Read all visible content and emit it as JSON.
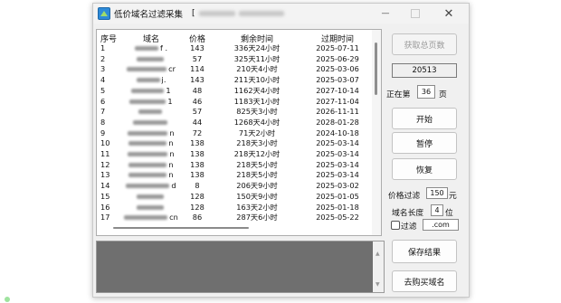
{
  "window": {
    "title": "低价域名过滤采集",
    "title_extra": "["
  },
  "controls": {
    "minimize": "—",
    "close": "✕"
  },
  "table": {
    "headers": [
      "序号",
      "域名",
      "价格",
      "剩余时间",
      "过期时间"
    ],
    "rows": [
      {
        "idx": "1",
        "domain": "f .",
        "price": "143",
        "remaining": "336天24小时",
        "expire": "2025-07-11"
      },
      {
        "idx": "2",
        "domain": "",
        "price": "57",
        "remaining": "325天11小时",
        "expire": "2025-06-29"
      },
      {
        "idx": "3",
        "domain": "cr",
        "price": "114",
        "remaining": "210天4小时",
        "expire": "2025-03-06"
      },
      {
        "idx": "4",
        "domain": "j.",
        "price": "143",
        "remaining": "211天10小时",
        "expire": "2025-03-07"
      },
      {
        "idx": "5",
        "domain": "1",
        "price": "48",
        "remaining": "1162天4小时",
        "expire": "2027-10-14"
      },
      {
        "idx": "6",
        "domain": "1",
        "price": "46",
        "remaining": "1183天1小时",
        "expire": "2027-11-04"
      },
      {
        "idx": "7",
        "domain": "",
        "price": "57",
        "remaining": "825天3小时",
        "expire": "2026-11-11"
      },
      {
        "idx": "8",
        "domain": "",
        "price": "44",
        "remaining": "1268天4小时",
        "expire": "2028-01-28"
      },
      {
        "idx": "9",
        "domain": "n",
        "price": "72",
        "remaining": "71天2小时",
        "expire": "2024-10-18"
      },
      {
        "idx": "10",
        "domain": "n",
        "price": "138",
        "remaining": "218天3小时",
        "expire": "2025-03-14"
      },
      {
        "idx": "11",
        "domain": "n",
        "price": "138",
        "remaining": "218天12小时",
        "expire": "2025-03-14"
      },
      {
        "idx": "12",
        "domain": "n",
        "price": "138",
        "remaining": "218天5小时",
        "expire": "2025-03-14"
      },
      {
        "idx": "13",
        "domain": "n",
        "price": "138",
        "remaining": "218天5小时",
        "expire": "2025-03-14"
      },
      {
        "idx": "14",
        "domain": "d",
        "price": "8",
        "remaining": "206天9小时",
        "expire": "2025-03-02"
      },
      {
        "idx": "15",
        "domain": "",
        "price": "128",
        "remaining": "150天9小时",
        "expire": "2025-01-05"
      },
      {
        "idx": "16",
        "domain": "",
        "price": "128",
        "remaining": "163天2小时",
        "expire": "2025-01-18"
      },
      {
        "idx": "17",
        "domain": "cn",
        "price": "86",
        "remaining": "287天6小时",
        "expire": "2025-05-22"
      }
    ]
  },
  "side": {
    "get_total_pages": "获取总页数",
    "total_pages_value": "20513",
    "current_page_prefix": "正在第",
    "current_page_value": "36",
    "current_page_suffix": "页",
    "start_button": "开始",
    "pause_button": "暂停",
    "resume_button": "恢复",
    "price_filter_label": "价格过滤",
    "price_filter_value": "150",
    "price_filter_unit": "元",
    "domain_length_label": "域名长度",
    "domain_length_value": "4",
    "domain_length_unit": "位",
    "filter_checkbox_label": "过滤",
    "filter_suffix_value": ".com",
    "save_button": "保存结果",
    "buy_button": "去购买域名"
  }
}
